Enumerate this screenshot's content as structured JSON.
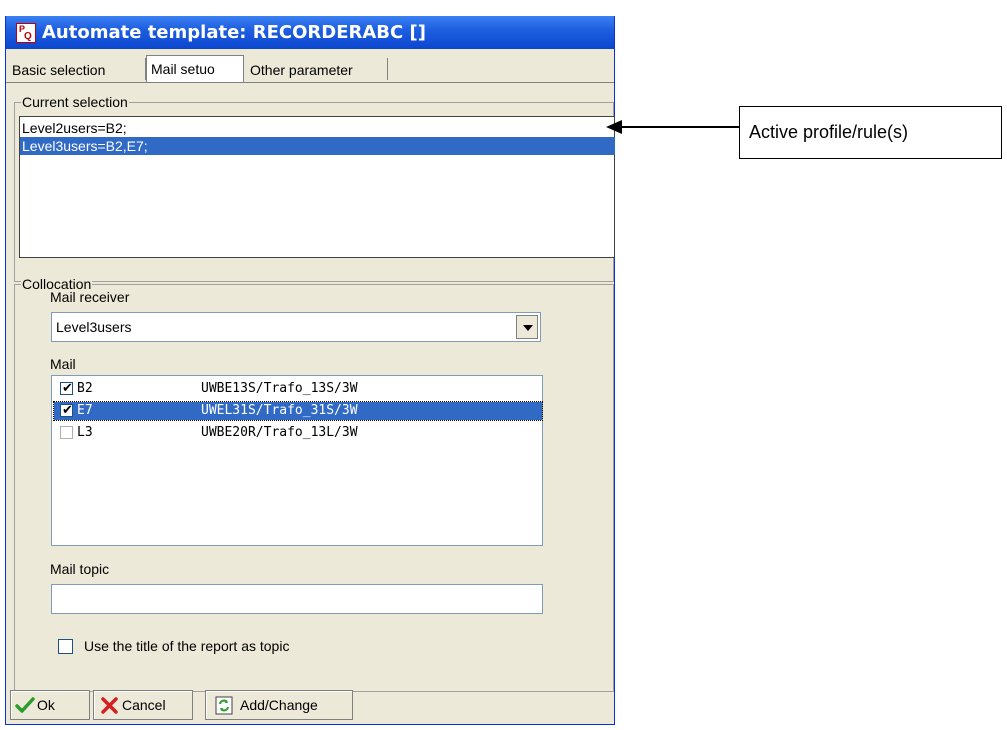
{
  "window": {
    "title": "Automate template: RECORDERABC []"
  },
  "tabs": [
    {
      "label": "Basic selection"
    },
    {
      "label": "Mail setuo"
    },
    {
      "label": "Other parameter"
    }
  ],
  "current_selection": {
    "group_label": "Current selection",
    "items": [
      {
        "text": "Level2users=B2;",
        "selected": false
      },
      {
        "text": "Level3users=B2,E7;",
        "selected": true
      }
    ]
  },
  "collocation": {
    "group_label": "Collocation",
    "mail_receiver_label": "Mail receiver",
    "mail_receiver_value": "Level3users",
    "mail_label": "Mail",
    "mail_rows": [
      {
        "code": "B2",
        "desc": "UWBE13S/Trafo_13S/3W",
        "checked": true,
        "selected": false
      },
      {
        "code": "E7",
        "desc": "UWEL31S/Trafo_31S/3W",
        "checked": true,
        "selected": true
      },
      {
        "code": "L3",
        "desc": "UWBE20R/Trafo_13L/3W",
        "checked": false,
        "selected": false
      }
    ],
    "mail_topic_label": "Mail topic",
    "mail_topic_value": "",
    "use_title_label": "Use the title of the report as topic",
    "use_title_checked": false
  },
  "buttons": {
    "ok": "Ok",
    "cancel": "Cancel",
    "add_change": "Add/Change"
  },
  "annotation": {
    "text": "Active profile/rule(s)"
  },
  "colors": {
    "selection": "#316ac5",
    "titlebar": "#1f5fe0",
    "ok_check": "#2a9d2a",
    "cancel_x": "#d42020"
  }
}
